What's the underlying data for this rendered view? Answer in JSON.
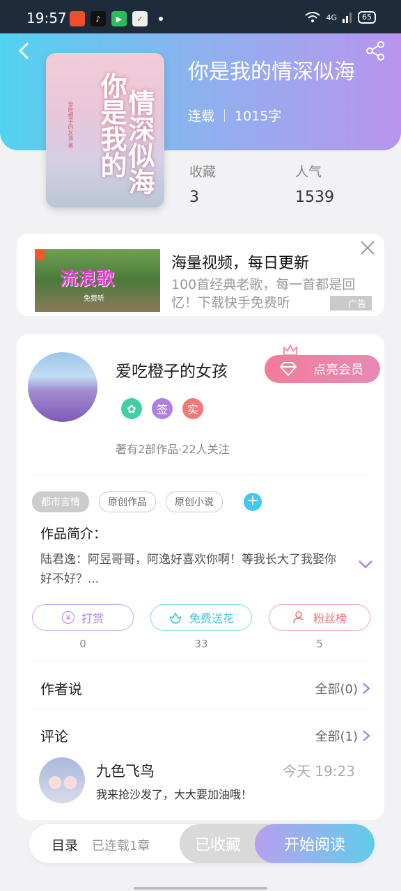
{
  "status_bar": {
    "time": "19:57",
    "network": "4G",
    "battery": "65",
    "app_icons": [
      "app-icon-1",
      "tiktok-icon",
      "video-icon",
      "news-icon"
    ]
  },
  "book": {
    "title": "你是我的情深似海",
    "status": "连载",
    "word_count": "1015字",
    "cover_title_col1": "你是我的",
    "cover_title_col2": "情深似海",
    "cover_author": "爱吃橙子的女孩 著",
    "stats": [
      {
        "label": "收藏",
        "value": "3"
      },
      {
        "label": "人气",
        "value": "1539"
      }
    ]
  },
  "ad": {
    "image_title": "流浪歌",
    "image_sub": "免费听",
    "title": "海量视频，每日更新",
    "desc": "100首经典老歌，每一首都是回忆！下载快手免费听",
    "tag": "广告"
  },
  "author": {
    "name": "爱吃橙子的女孩",
    "vip_label": "点亮会员",
    "badges": [
      {
        "text": "",
        "color": "#3fcfa4"
      },
      {
        "text": "签",
        "color": "#b07fe4"
      },
      {
        "text": "实",
        "color": "#f07878"
      }
    ],
    "stats": "著有2部作品·22人关注"
  },
  "tags": [
    "都市言情",
    "原创作品",
    "原创小说"
  ],
  "intro": {
    "label": "作品简介：",
    "text": "陆君逸：阿昱哥哥，阿逸好喜欢你啊！等我长大了我娶你好不好？..."
  },
  "actions": [
    {
      "label": "打赏",
      "count": "0",
      "color": "#b07fe4"
    },
    {
      "label": "免费送花",
      "count": "33",
      "color": "#3ec8d8"
    },
    {
      "label": "粉丝榜",
      "count": "5",
      "color": "#f07878"
    }
  ],
  "author_says": {
    "title": "作者说",
    "link": "全部(0)"
  },
  "comments": {
    "title": "评论",
    "link": "全部(1)",
    "items": [
      {
        "user": "九色飞鸟",
        "time": "今天 19:23",
        "text": "我来抢沙发了，大大要加油哦！"
      }
    ]
  },
  "bottom_bar": {
    "toc_label": "目录",
    "toc_sub": "已连载1章",
    "collected_label": "已收藏",
    "read_label": "开始阅读"
  },
  "colors": {
    "header_start": "#52d3ef",
    "header_end": "#b895ee",
    "vip_pink": "#f17d98",
    "accent_purple": "#b07fe4"
  }
}
